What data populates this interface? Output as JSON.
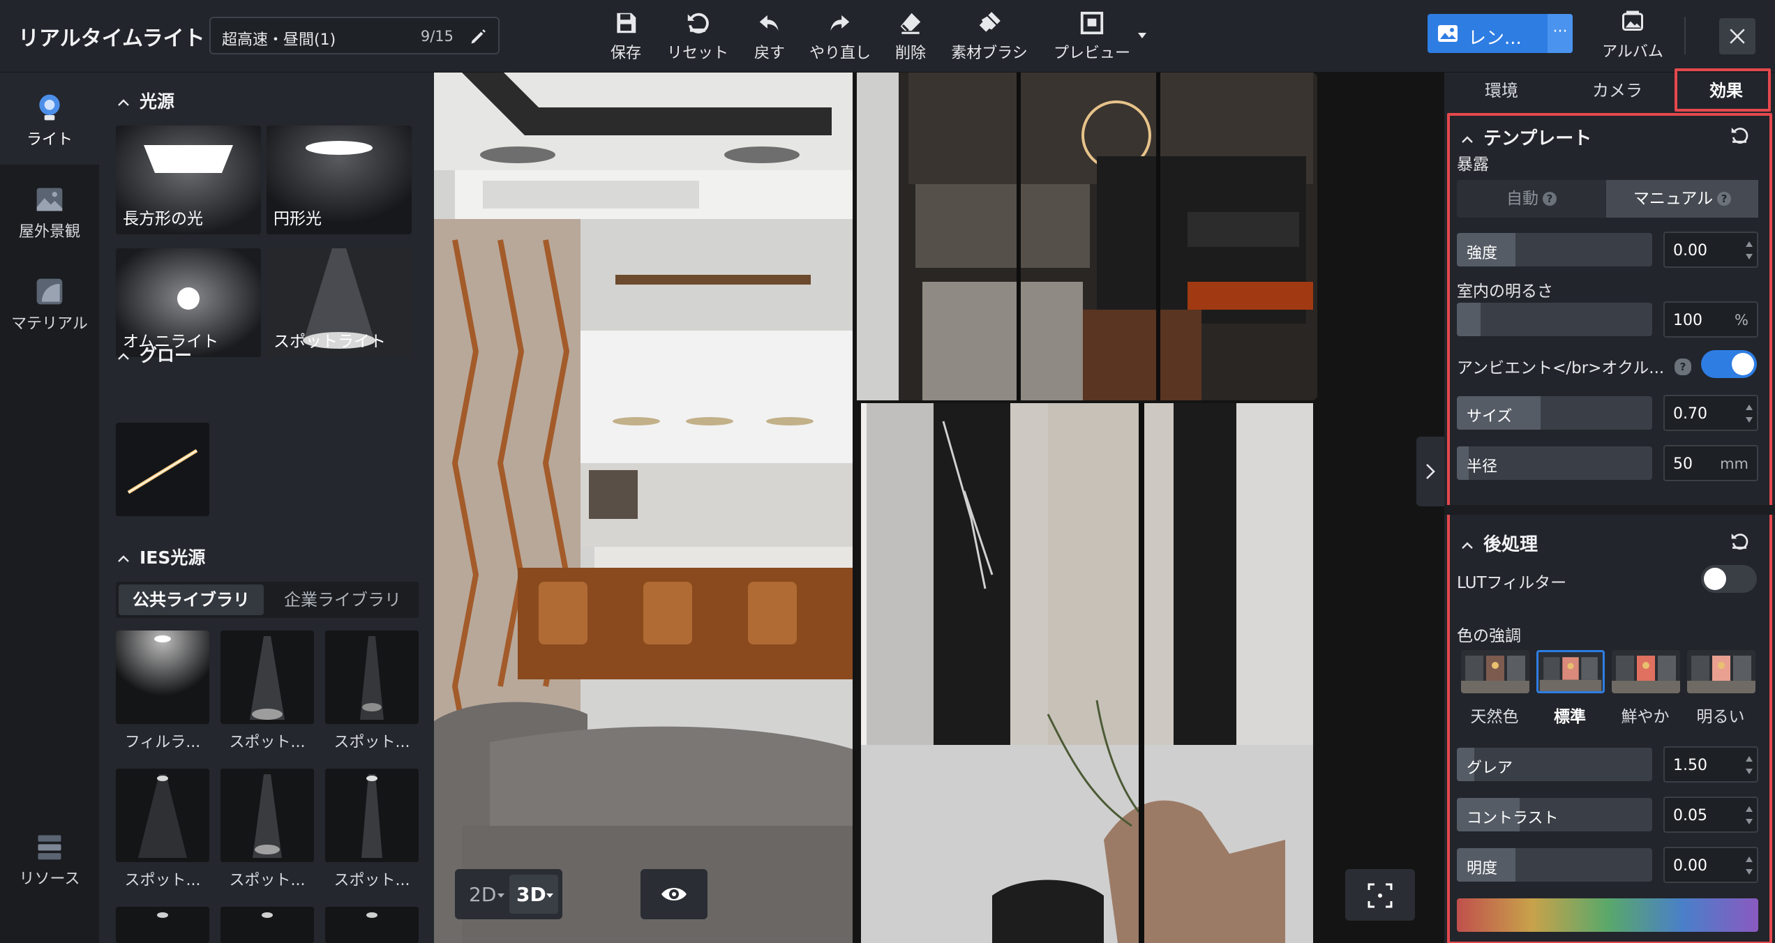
{
  "app": {
    "title": "リアルタイムライト"
  },
  "scene": {
    "name": "超高速・昼間(1)",
    "count": "9/15"
  },
  "toolbar": [
    {
      "label": "保存",
      "icon": "save-icon"
    },
    {
      "label": "リセット",
      "icon": "reset-icon"
    },
    {
      "label": "戻す",
      "icon": "undo-icon"
    },
    {
      "label": "やり直し",
      "icon": "redo-icon"
    },
    {
      "label": "削除",
      "icon": "eraser-icon"
    },
    {
      "label": "素材ブラシ",
      "icon": "brush-icon"
    },
    {
      "label": "プレビュー",
      "icon": "preview-icon"
    }
  ],
  "render": {
    "label": "レン...",
    "more": "···"
  },
  "album": {
    "label": "アルバム"
  },
  "sidebar": [
    {
      "label": "ライト",
      "icon": "bulb-icon"
    },
    {
      "label": "屋外景観",
      "icon": "landscape-icon"
    },
    {
      "label": "マテリアル",
      "icon": "material-icon"
    },
    {
      "label": "リソース",
      "icon": "resource-icon"
    }
  ],
  "light_panel": {
    "sources_title": "光源",
    "sources": [
      "長方形の光",
      "円形光",
      "オムニライト",
      "スポットライト"
    ],
    "glow_title": "グロー",
    "ies_title": "IES光源",
    "ies_tabs": [
      "公共ライブラリ",
      "企業ライブラリ"
    ],
    "ies_items": [
      "フィルラ...",
      "スポット...",
      "スポット...",
      "スポット...",
      "スポット...",
      "スポット..."
    ]
  },
  "viewport": {
    "mode_2d": "2D",
    "mode_3d": "3D"
  },
  "right_panel": {
    "tabs": [
      "環境",
      "カメラ",
      "効果"
    ],
    "template": {
      "title": "テンプレート",
      "exposure_label": "暴露",
      "mode_auto": "自動",
      "mode_manual": "マニュアル",
      "intensity_label": "強度",
      "intensity_value": "0.00",
      "intensity_level": 0.3,
      "brightness_label": "室内の明るさ",
      "brightness_value": "100",
      "brightness_unit": "%",
      "brightness_level": 0.12,
      "ao_label": "アンビエント</br>オクル...",
      "ao_on": true,
      "size_label": "サイズ",
      "size_value": "0.70",
      "size_level": 0.43,
      "radius_label": "半径",
      "radius_value": "50",
      "radius_unit": "mm",
      "radius_level": 0.06
    },
    "post": {
      "title": "後処理",
      "lut_label": "LUTフィルター",
      "lut_on": false,
      "color_label": "色の強調",
      "presets": [
        "天然色",
        "標準",
        "鮮やか",
        "明るい"
      ],
      "selected_preset": 1,
      "glare_label": "グレア",
      "glare_value": "1.50",
      "glare_level": 0.09,
      "contrast_label": "コントラスト",
      "contrast_value": "0.05",
      "contrast_level": 0.32,
      "clarity_label": "明度",
      "clarity_value": "0.00",
      "clarity_level": 0.3
    }
  },
  "colors": {
    "accent": "#2e7de3",
    "highlight": "#e5484d",
    "panel": "#22252b"
  }
}
